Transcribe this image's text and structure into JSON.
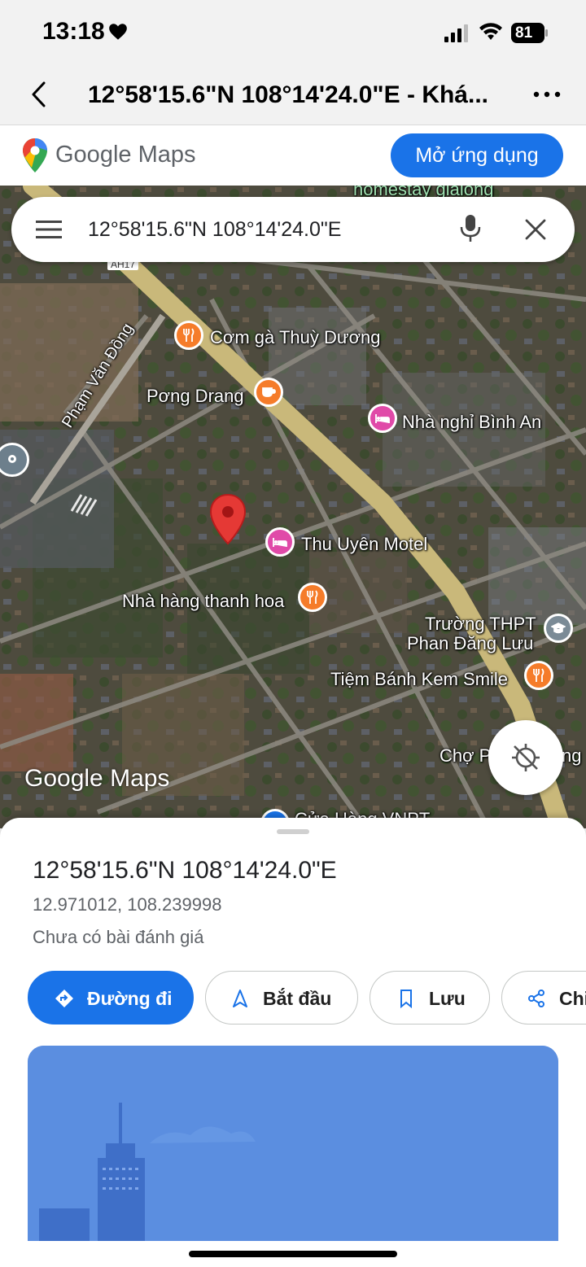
{
  "status": {
    "time": "13:18",
    "battery": "81"
  },
  "browser": {
    "title": "12°58'15.6\"N 108°14'24.0\"E - Khá..."
  },
  "gm_bar": {
    "logo_google": "Google",
    "logo_maps": "Maps",
    "open_app": "Mở ứng dụng"
  },
  "search": {
    "value": "12°58'15.6\"N 108°14'24.0\"E"
  },
  "map": {
    "labels": {
      "homestay": "homestay giaiong",
      "road_ah17": "AH17",
      "pham_van_dong": "Phạm Văn Đồng",
      "com_ga": "Cơm gà Thuỳ Dương",
      "pong_drang": "Pơng Drang",
      "nha_nghi": "Nhà nghỉ Bình An",
      "thu_uyen": "Thu Uyên Motel",
      "nha_hang": "Nhà hàng thanh hoa",
      "truong_line1": "Trường THPT",
      "truong_line2": "Phan Đăng Lưu",
      "tiem_banh": "Tiệm Bánh Kem Smile",
      "cho_part1": "Chợ P",
      "cho_part2": "ng",
      "cua_hang": "Cửa Hàng VNPT"
    },
    "watermark": "Google Maps",
    "colors": {
      "food": "#f57c2a",
      "lodging": "#e04aa8",
      "school": "#7b8b96",
      "pin": "#e53935"
    }
  },
  "place": {
    "title": "12°58'15.6\"N 108°14'24.0\"E",
    "decimal": "12.971012, 108.239998",
    "reviews": "Chưa có bài đánh giá"
  },
  "actions": {
    "directions": "Đường đi",
    "start": "Bắt đầu",
    "save": "Lưu",
    "share": "Chi"
  }
}
